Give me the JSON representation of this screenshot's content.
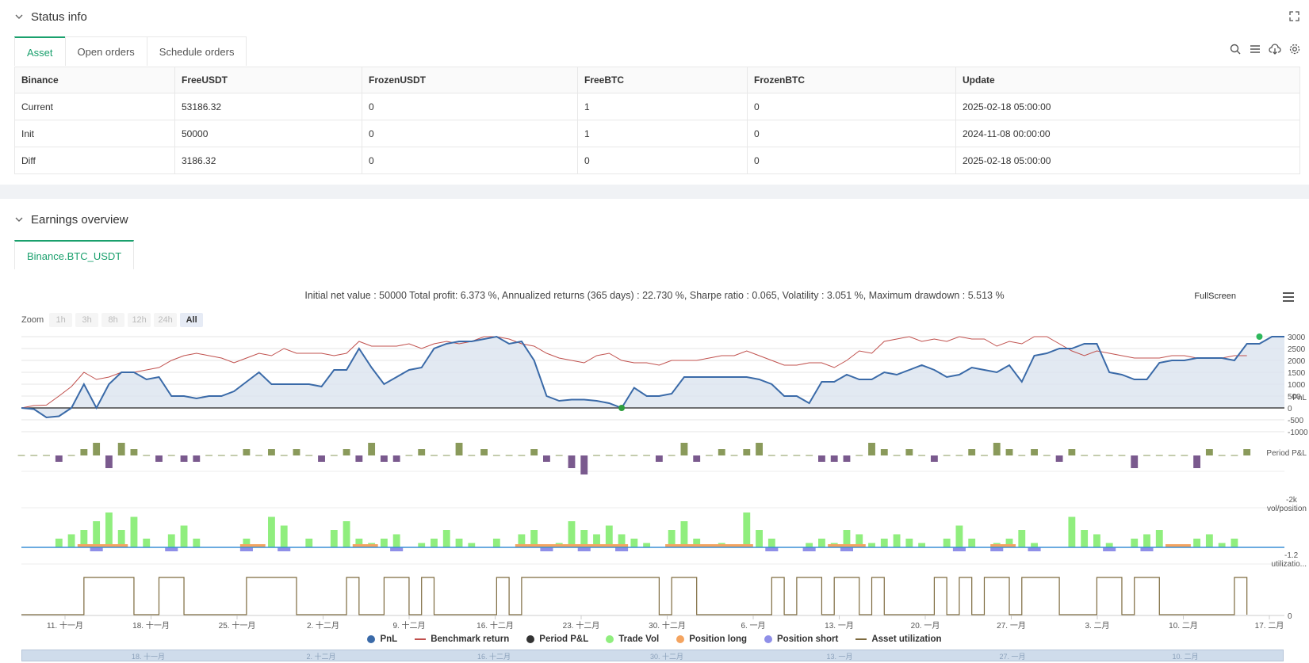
{
  "status_section": {
    "title": "Status info"
  },
  "tabs": [
    {
      "label": "Asset",
      "active": true
    },
    {
      "label": "Open orders",
      "active": false
    },
    {
      "label": "Schedule orders",
      "active": false
    }
  ],
  "asset_table": {
    "columns": [
      "Binance",
      "FreeUSDT",
      "FrozenUSDT",
      "FreeBTC",
      "FrozenBTC",
      "Update"
    ],
    "rows": [
      {
        "name": "Current",
        "free_usdt": "53186.32",
        "frozen_usdt": "0",
        "free_btc": "1",
        "frozen_btc": "0",
        "update": "2025-02-18 05:00:00"
      },
      {
        "name": "Init",
        "free_usdt": "50000",
        "frozen_usdt": "0",
        "free_btc": "1",
        "frozen_btc": "0",
        "update": "2024-11-08 00:00:00"
      },
      {
        "name": "Diff",
        "free_usdt": "3186.32",
        "frozen_usdt": "0",
        "free_btc": "0",
        "frozen_btc": "0",
        "update": "2025-02-18 05:00:00"
      }
    ]
  },
  "earnings_section": {
    "title": "Earnings overview",
    "tab": "Binance.BTC_USDT"
  },
  "summary": "Initial net value : 50000 Total profit: 6.373 %, Annualized returns (365 days) : 22.730 %, Sharpe ratio : 0.065, Volatility : 3.051 %, Maximum drawdown : 5.513 %",
  "fullscreen_label": "FullScreen",
  "zoom": {
    "label": "Zoom",
    "buttons": [
      "1h",
      "3h",
      "8h",
      "12h",
      "24h",
      "All"
    ],
    "active": "All"
  },
  "colors": {
    "pnl": "#3a6aa8",
    "benchmark": "#c0504d",
    "period_pos": "#8a9a5b",
    "period_neg": "#7a5a8e",
    "trade_vol": "#90ee7e",
    "pos_long": "#f4a460",
    "pos_short": "#8f8fe8",
    "asset_util": "#7d6a3e",
    "accent": "#1aa06d"
  },
  "chart_data": {
    "type": "line",
    "x_ticks": [
      "11. 十一月",
      "18. 十一月",
      "25. 十一月",
      "2. 十二月",
      "9. 十二月",
      "16. 十二月",
      "23. 十二月",
      "30. 十二月",
      "6. 一月",
      "13. 一月",
      "20. 一月",
      "27. 一月",
      "3. 二月",
      "10. 二月",
      "17. 二月"
    ],
    "navigator_ticks": [
      "18. 十一月",
      "2. 十二月",
      "16. 十二月",
      "30. 十二月",
      "13. 一月",
      "27. 一月",
      "10. 二月"
    ],
    "panels": [
      {
        "name": "PnL",
        "y_ticks": [
          "3000",
          "2500",
          "2000",
          "1500",
          "1000",
          "500",
          "0",
          "-500",
          "-1000"
        ],
        "ylim": [
          -1000,
          3000
        ]
      },
      {
        "name": "Period P&L",
        "y_ticks": [
          "-2k"
        ]
      },
      {
        "name": "vol/position",
        "y_ticks": [
          "-1.2"
        ]
      },
      {
        "name": "utilizatio...",
        "y_ticks": [
          "0"
        ]
      }
    ],
    "series": [
      {
        "name": "PnL",
        "values": [
          0,
          -50,
          -400,
          -350,
          0,
          1000,
          0,
          1000,
          1500,
          1500,
          1200,
          1300,
          500,
          500,
          400,
          500,
          500,
          700,
          1100,
          1500,
          1000,
          1000,
          1000,
          1000,
          900,
          1600,
          1600,
          2500,
          1700,
          1000,
          1300,
          1600,
          1700,
          2500,
          2700,
          2800,
          2800,
          2900,
          3000,
          2700,
          2800,
          2000,
          500,
          300,
          350,
          350,
          300,
          200,
          0,
          850,
          500,
          500,
          600,
          1300,
          1300,
          1300,
          1300,
          1300,
          1300,
          1200,
          1000,
          500,
          500,
          200,
          1100,
          1100,
          1400,
          1200,
          1200,
          1500,
          1400,
          1600,
          1800,
          1600,
          1300,
          1400,
          1700,
          1600,
          1500,
          1800,
          1100,
          2200,
          2300,
          2500,
          2500,
          2700,
          2700,
          1500,
          1400,
          1200,
          1200,
          1900,
          2000,
          2000,
          2100,
          2100,
          2100,
          2000,
          2700,
          2700,
          3000,
          3000
        ]
      },
      {
        "name": "Benchmark return",
        "values": [
          0,
          100,
          120,
          500,
          900,
          1500,
          1200,
          1300,
          1500,
          1500,
          1600,
          1700,
          2000,
          2200,
          2300,
          2200,
          2100,
          1900,
          2100,
          2300,
          2200,
          2500,
          2300,
          2300,
          2300,
          2200,
          2300,
          2800,
          2600,
          2600,
          2600,
          2700,
          2500,
          2700,
          2800,
          2700,
          2800,
          3000,
          3000,
          2900,
          2700,
          2600,
          2300,
          2100,
          2000,
          1900,
          2200,
          2300,
          2000,
          1900,
          1900,
          1800,
          2000,
          2000,
          2000,
          2100,
          2200,
          2200,
          2400,
          2200,
          2000,
          1800,
          1800,
          1900,
          1900,
          1700,
          2000,
          2400,
          2300,
          2800,
          2900,
          3000,
          2800,
          2900,
          2800,
          3000,
          2900,
          2900,
          2600,
          2800,
          2700,
          3000,
          3000,
          2700,
          2400,
          2200,
          2400,
          2300,
          2200,
          2100,
          2100,
          2100,
          2200,
          2200,
          2100,
          2100,
          2100,
          2200,
          2200
        ]
      }
    ],
    "period_pnl": [
      0,
      0,
      0,
      -1,
      0,
      1,
      2,
      -2,
      2,
      1,
      0,
      -1,
      0,
      -1,
      -1,
      0,
      0,
      0,
      1,
      0,
      1,
      0,
      1,
      0,
      -1,
      0,
      1,
      -1,
      2,
      -1,
      -1,
      0,
      1,
      0,
      0,
      2,
      0,
      1,
      0,
      0,
      0,
      1,
      -1,
      0,
      -2,
      -3,
      0,
      0,
      0,
      0,
      0,
      -1,
      0,
      2,
      -1,
      0,
      1,
      0,
      1,
      2,
      0,
      0,
      0,
      0,
      -1,
      -1,
      -1,
      0,
      2,
      1,
      0,
      1,
      0,
      -1,
      0,
      0,
      1,
      0,
      2,
      1,
      0,
      1,
      0,
      -1,
      1,
      0,
      0,
      0,
      0,
      -2,
      0,
      0,
      0,
      0,
      -2,
      1,
      0,
      0,
      1
    ],
    "trade_vol": [
      0,
      0,
      0,
      2,
      3,
      4,
      6,
      8,
      4,
      7,
      2,
      0,
      3,
      5,
      2,
      0,
      0,
      0,
      2,
      0,
      7,
      5,
      0,
      2,
      0,
      4,
      6,
      2,
      1,
      2,
      3,
      0,
      1,
      2,
      4,
      2,
      1,
      0,
      2,
      0,
      3,
      4,
      0,
      1,
      6,
      4,
      3,
      5,
      3,
      2,
      1,
      0,
      4,
      6,
      2,
      0,
      1,
      0,
      8,
      4,
      2,
      0,
      0,
      1,
      2,
      1,
      4,
      3,
      1,
      2,
      3,
      2,
      1,
      0,
      2,
      5,
      2,
      0,
      1,
      2,
      4,
      1,
      0,
      0,
      7,
      4,
      3,
      1,
      0,
      2,
      3,
      4,
      0,
      0,
      2,
      3,
      1,
      2,
      0
    ],
    "position_long": [
      0,
      0,
      0,
      0,
      0,
      1,
      1,
      1,
      1,
      0,
      0,
      0,
      0,
      0,
      0,
      0,
      0,
      0,
      1,
      1,
      0,
      0,
      0,
      0,
      0,
      0,
      0,
      1,
      1,
      0,
      0,
      0,
      0,
      0,
      0,
      0,
      0,
      0,
      0,
      0,
      1,
      1,
      1,
      1,
      1,
      1,
      1,
      1,
      1,
      0,
      0,
      0,
      1,
      1,
      1,
      1,
      1,
      1,
      1,
      0,
      0,
      0,
      0,
      0,
      0,
      1,
      1,
      1,
      0,
      0,
      0,
      0,
      0,
      0,
      0,
      0,
      0,
      0,
      1,
      1,
      0,
      0,
      0,
      0,
      0,
      0,
      0,
      0,
      0,
      0,
      0,
      0,
      1,
      1,
      0,
      0,
      0,
      0,
      0
    ],
    "asset_utilization": [
      0,
      0,
      0,
      0,
      0,
      1,
      1,
      1,
      1,
      0,
      0,
      1,
      1,
      0,
      0,
      0,
      0,
      0,
      1,
      1,
      1,
      1,
      0,
      0,
      0,
      0,
      1,
      0,
      0,
      1,
      1,
      0,
      1,
      0,
      0,
      0,
      0,
      0,
      1,
      0,
      1,
      1,
      1,
      1,
      1,
      1,
      1,
      1,
      1,
      1,
      1,
      0,
      1,
      1,
      0,
      0,
      0,
      0,
      0,
      0,
      1,
      0,
      1,
      1,
      0,
      1,
      1,
      0,
      1,
      0,
      0,
      0,
      0,
      1,
      0,
      1,
      0,
      1,
      1,
      0,
      1,
      1,
      1,
      0,
      0,
      0,
      1,
      1,
      0,
      1,
      1,
      0,
      0,
      0,
      0,
      0,
      0,
      1,
      0
    ]
  },
  "legend": [
    {
      "label": "PnL",
      "kind": "dot",
      "color": "#3a6aa8"
    },
    {
      "label": "Benchmark return",
      "kind": "line",
      "color": "#c0504d"
    },
    {
      "label": "Period P&L",
      "kind": "dot",
      "color": "#333333"
    },
    {
      "label": "Trade Vol",
      "kind": "dot",
      "color": "#90ee7e"
    },
    {
      "label": "Position long",
      "kind": "dot",
      "color": "#f4a460"
    },
    {
      "label": "Position short",
      "kind": "dot",
      "color": "#8f8fe8"
    },
    {
      "label": "Asset utilization",
      "kind": "line",
      "color": "#7d6a3e"
    }
  ]
}
